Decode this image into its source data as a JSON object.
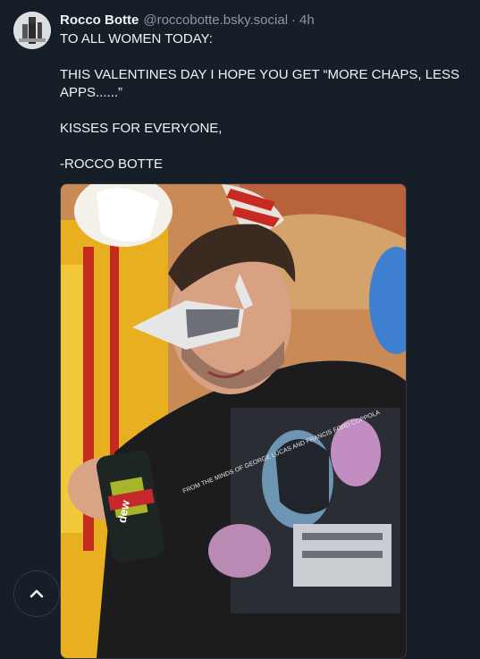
{
  "post": {
    "author_name": "Rocco Botte",
    "author_handle": "@roccobotte.bsky.social",
    "separator": "·",
    "time_ago": "4h",
    "lines": [
      "TO ALL WOMEN TODAY:",
      "THIS VALENTINES DAY I HOPE YOU GET “MORE CHAPS, LESS APPS......”",
      "KISSES FOR EVERYONE,",
      "-ROCCO BOTTE"
    ],
    "shirt_text": "FROM THE MINDS OF GEORGE LUCAS AND FRANCIS FORD COPPOLA",
    "can_text": "dew"
  },
  "icons": {
    "scroll_top": "chevron-up-icon"
  },
  "colors": {
    "background": "#161e27",
    "text": "#f1f3f5",
    "muted": "#8b98a5"
  }
}
